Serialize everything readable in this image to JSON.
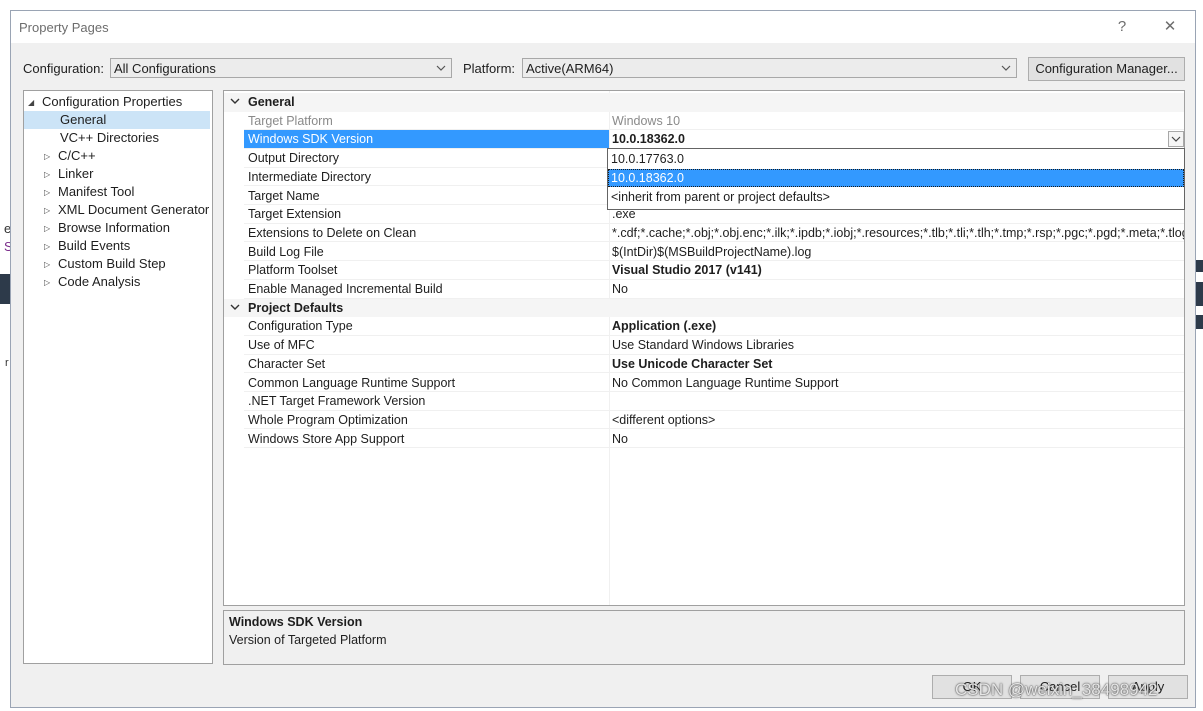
{
  "window": {
    "title": "Property Pages",
    "help_glyph": "?",
    "close_glyph": "✕"
  },
  "toolbar": {
    "configuration_label": "Configuration:",
    "configuration_value": "All Configurations",
    "platform_label": "Platform:",
    "platform_value": "Active(ARM64)",
    "config_manager_label": "Configuration Manager..."
  },
  "tree": {
    "root": "Configuration Properties",
    "items": [
      {
        "label": "General",
        "selected": true,
        "expandable": false
      },
      {
        "label": "VC++ Directories",
        "selected": false,
        "expandable": false
      },
      {
        "label": "C/C++",
        "selected": false,
        "expandable": true
      },
      {
        "label": "Linker",
        "selected": false,
        "expandable": true
      },
      {
        "label": "Manifest Tool",
        "selected": false,
        "expandable": true
      },
      {
        "label": "XML Document Generator",
        "selected": false,
        "expandable": true
      },
      {
        "label": "Browse Information",
        "selected": false,
        "expandable": true
      },
      {
        "label": "Build Events",
        "selected": false,
        "expandable": true
      },
      {
        "label": "Custom Build Step",
        "selected": false,
        "expandable": true
      },
      {
        "label": "Code Analysis",
        "selected": false,
        "expandable": true
      }
    ]
  },
  "grid": {
    "general": {
      "title": "General",
      "rows": [
        {
          "name": "Target Platform",
          "value": "Windows 10"
        },
        {
          "name": "Windows SDK Version",
          "value": "10.0.18362.0"
        },
        {
          "name": "Output Directory",
          "value": ""
        },
        {
          "name": "Intermediate Directory",
          "value": ""
        },
        {
          "name": "Target Name",
          "value": ""
        },
        {
          "name": "Target Extension",
          "value": ".exe"
        },
        {
          "name": "Extensions to Delete on Clean",
          "value": "*.cdf;*.cache;*.obj;*.obj.enc;*.ilk;*.ipdb;*.iobj;*.resources;*.tlb;*.tli;*.tlh;*.tmp;*.rsp;*.pgc;*.pgd;*.meta;*.tlog;*.ma"
        },
        {
          "name": "Build Log File",
          "value": "$(IntDir)$(MSBuildProjectName).log"
        },
        {
          "name": "Platform Toolset",
          "value": "Visual Studio 2017 (v141)"
        },
        {
          "name": "Enable Managed Incremental Build",
          "value": "No"
        }
      ]
    },
    "project_defaults": {
      "title": "Project Defaults",
      "rows": [
        {
          "name": "Configuration Type",
          "value": "Application (.exe)"
        },
        {
          "name": "Use of MFC",
          "value": "Use Standard Windows Libraries"
        },
        {
          "name": "Character Set",
          "value": "Use Unicode Character Set"
        },
        {
          "name": "Common Language Runtime Support",
          "value": "No Common Language Runtime Support"
        },
        {
          "name": ".NET Target Framework Version",
          "value": ""
        },
        {
          "name": "Whole Program Optimization",
          "value": "<different options>"
        },
        {
          "name": "Windows Store App Support",
          "value": "No"
        }
      ]
    }
  },
  "dropdown": {
    "options": [
      "10.0.17763.0",
      "10.0.18362.0",
      "<inherit from parent or project defaults>"
    ],
    "selected_index": 1
  },
  "description": {
    "title": "Windows SDK Version",
    "text": "Version of Targeted Platform"
  },
  "buttons": {
    "ok": "OK",
    "cancel": "Cancel",
    "apply": "Apply"
  },
  "watermark": "CSDN @weixin_38498942",
  "background_glyphs": [
    "e",
    "S",
    "r"
  ]
}
